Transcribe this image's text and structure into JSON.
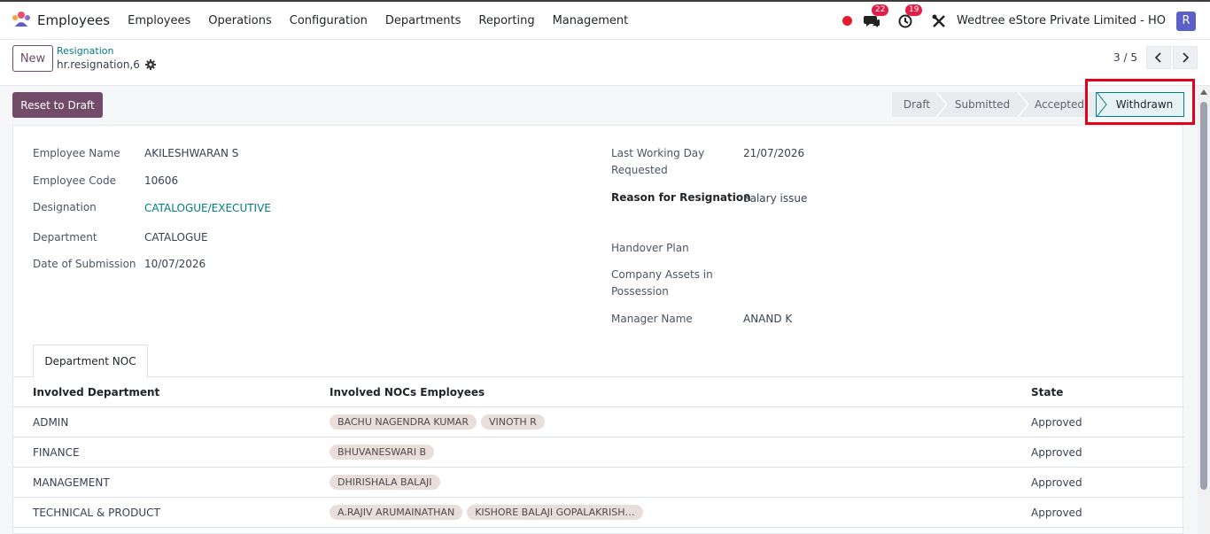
{
  "navbar": {
    "app_name": "Employees",
    "menu": [
      "Employees",
      "Operations",
      "Configuration",
      "Departments",
      "Reporting",
      "Management"
    ],
    "chat_badge": "22",
    "activity_badge": "19",
    "company": "Wedtree eStore Private Limited - HO",
    "avatar_letter": "R",
    "accent": "#714b67"
  },
  "control": {
    "new_label": "New",
    "breadcrumb_parent": "Resignation",
    "breadcrumb_current": "hr.resignation,6",
    "pager": "3 / 5"
  },
  "status": {
    "reset_label": "Reset to Draft",
    "steps": [
      "Draft",
      "Submitted",
      "Accepted",
      "Withdrawn"
    ],
    "active_step": "Withdrawn"
  },
  "form": {
    "left": [
      {
        "label": "Employee Name",
        "value": "AKILESHWARAN S"
      },
      {
        "label": "Employee Code",
        "value": "10606"
      },
      {
        "label": "Designation",
        "value": "CATALOGUE/EXECUTIVE"
      },
      {
        "label": "Department",
        "value": "CATALOGUE"
      },
      {
        "label": "Date of Submission",
        "value": "10/07/2026"
      }
    ],
    "right": [
      {
        "label_line1": "Last Working Day",
        "label_line2": "Requested",
        "value": "21/07/2026"
      },
      {
        "label": "Reason for Resignation",
        "value": "Salary issue"
      },
      {
        "label": "Handover Plan",
        "value": ""
      },
      {
        "label_line1": "Company Assets in",
        "label_line2": "Possession",
        "value": ""
      },
      {
        "label": "Manager Name",
        "value": "ANAND K"
      }
    ]
  },
  "tabs": {
    "active": "Department NOC"
  },
  "noc_table": {
    "headers": [
      "Involved Department",
      "Involved NOCs Employees",
      "State"
    ],
    "rows": [
      {
        "department": "ADMIN",
        "employees": [
          "BACHU NAGENDRA KUMAR",
          "VINOTH R"
        ],
        "state": "Approved"
      },
      {
        "department": "FINANCE",
        "employees": [
          "BHUVANESWARI B"
        ],
        "state": "Approved"
      },
      {
        "department": "MANAGEMENT",
        "employees": [
          "DHIRISHALA BALAJI"
        ],
        "state": "Approved"
      },
      {
        "department": "TECHNICAL & PRODUCT",
        "employees": [
          "A.RAJIV ARUMAINATHAN",
          "KISHORE BALAJI GOPALAKRISHNAN"
        ],
        "state": "Approved"
      }
    ]
  }
}
